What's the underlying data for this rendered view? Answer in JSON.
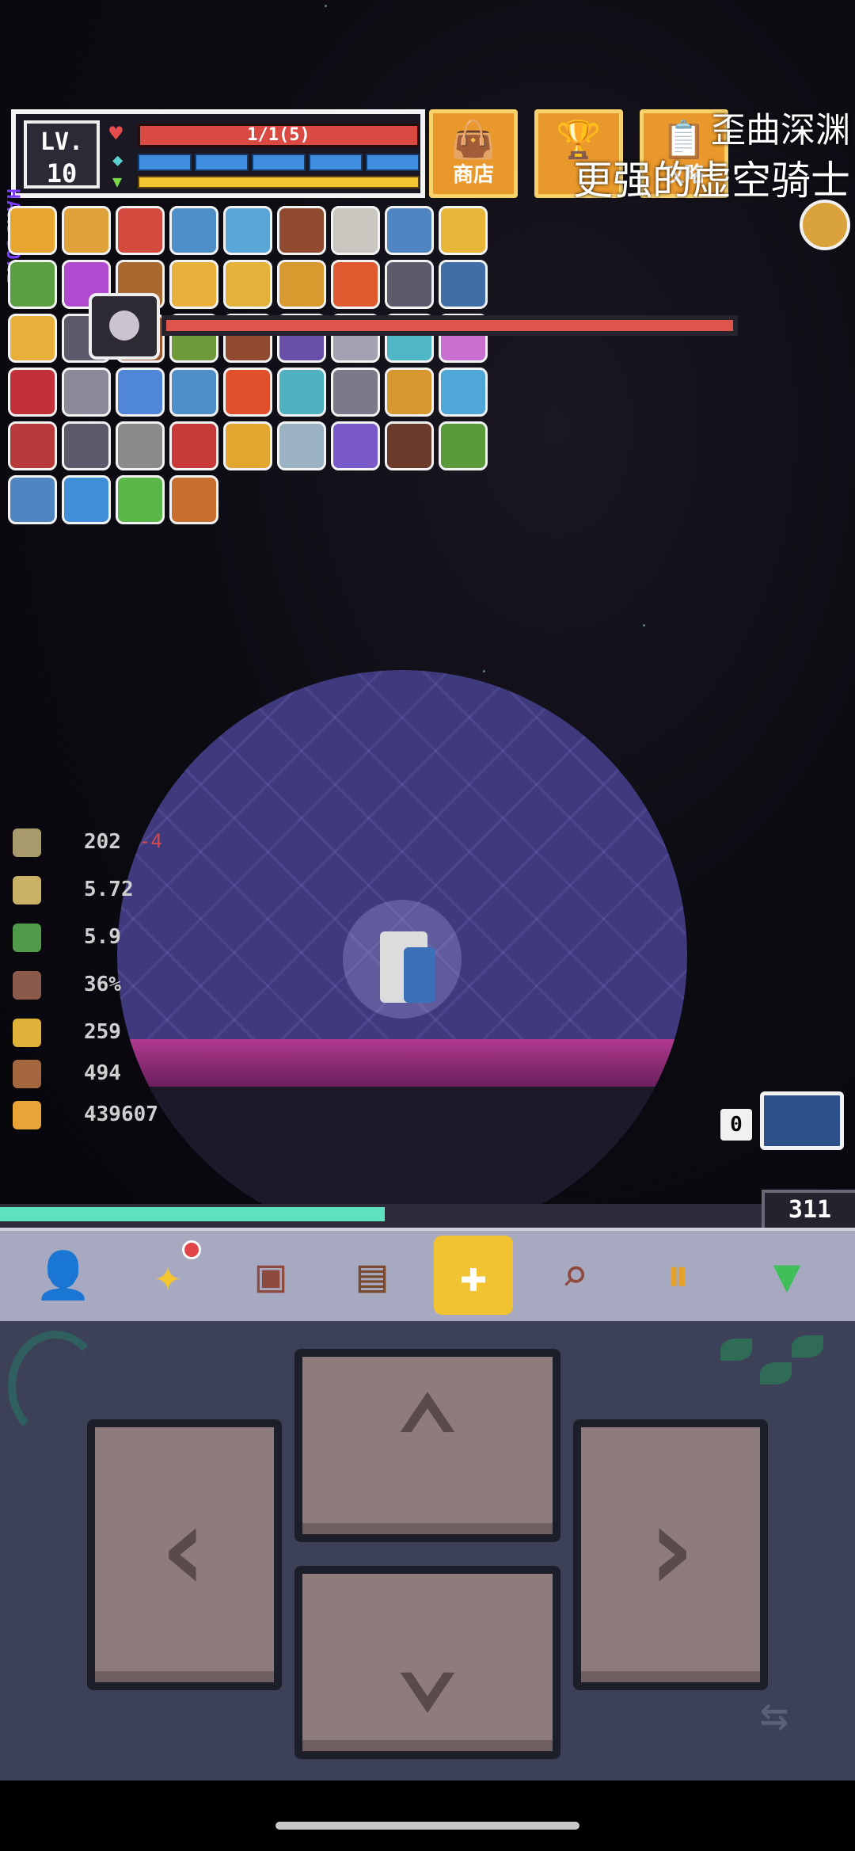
{
  "hud": {
    "level_label": "LV.",
    "level": "10",
    "hp_text": "1/1(5)",
    "armor_segments": 5
  },
  "top_buttons": [
    {
      "label": "商店",
      "icon": "shop-bag-icon",
      "color": "#e9982b"
    },
    {
      "label": "",
      "icon": "trophy-icon",
      "color": "#e9982b"
    },
    {
      "label": "攻略",
      "icon": "guide-book-icon",
      "color": "#e9982b"
    }
  ],
  "overlay": {
    "title": "歪曲深渊",
    "subtitle": "更强的虚空骑士"
  },
  "mode_label": "HARDCORE",
  "stats": [
    {
      "icon": "attack-icon",
      "value": "202",
      "delta": "-4",
      "color": "#a89a6b"
    },
    {
      "icon": "attack-speed-icon",
      "value": "5.72",
      "delta": "",
      "color": "#c9b266"
    },
    {
      "icon": "move-speed-boot-icon",
      "value": "5.9",
      "delta": "",
      "color": "#4f9b4a"
    },
    {
      "icon": "crit-icon",
      "value": "36%",
      "delta": "",
      "color": "#8a5a4a"
    },
    {
      "icon": "gold-key-icon",
      "value": "259",
      "delta": "",
      "color": "#e0b23a"
    },
    {
      "icon": "bronze-key-icon",
      "value": "494",
      "delta": "",
      "color": "#a5673f"
    },
    {
      "icon": "gold-coin-icon",
      "value": "439607",
      "delta": "",
      "color": "#e8a437"
    }
  ],
  "xp": {
    "fill_fraction": 0.45,
    "coins": "311"
  },
  "weapon": {
    "count": "0"
  },
  "toolbar": [
    {
      "icon": "character-icon",
      "glyph": "👤",
      "badge": false
    },
    {
      "icon": "sparkle-skill-icon",
      "glyph": "✦",
      "badge": true
    },
    {
      "icon": "journal-icon",
      "glyph": "▣",
      "badge": false
    },
    {
      "icon": "backpack-icon",
      "glyph": "▤",
      "badge": false
    },
    {
      "icon": "target-focus-icon",
      "glyph": "✚",
      "badge": false
    },
    {
      "icon": "magnify-icon",
      "glyph": "⌕",
      "badge": false
    },
    {
      "icon": "pause-icon",
      "glyph": "⏸",
      "badge": false
    },
    {
      "icon": "dropdown-arrow-icon",
      "glyph": "▼",
      "badge": false
    }
  ],
  "item_colors": [
    "#e7a62f",
    "#e0a33a",
    "#d34b3f",
    "#4f8fc8",
    "#5aa6d8",
    "#8f4a2f",
    "#c9c6c0",
    "#4f86c2",
    "#e8b73a",
    "#5aa042",
    "#b04bd0",
    "#a8682f",
    "#e8b03a",
    "#e2b23a",
    "#d89a2e",
    "#e05a2f",
    "#5b5b6b",
    "#3f6fa6",
    "#e8b03a",
    "#5a5a6a",
    "#a0582f",
    "#6f9a3a",
    "#8f4a2f",
    "#6a4fa8",
    "#a2a2b2",
    "#4fb6c6",
    "#c86fd0",
    "#c2303a",
    "#8a8a9a",
    "#4f86d8",
    "#4f8fc8",
    "#e0502a",
    "#4fb0c0",
    "#7a7a8a",
    "#d8962e",
    "#4fa6d8",
    "#b83a3a",
    "#5a5a6a",
    "#8a8a8a",
    "#c83a3a",
    "#e0a62f",
    "#9ab2c2",
    "#7a5ac8",
    "#6a3a2a",
    "#5a9a3a",
    "#4f86c2",
    "#3f8fd8",
    "#5ab84a",
    "#c8702f"
  ]
}
